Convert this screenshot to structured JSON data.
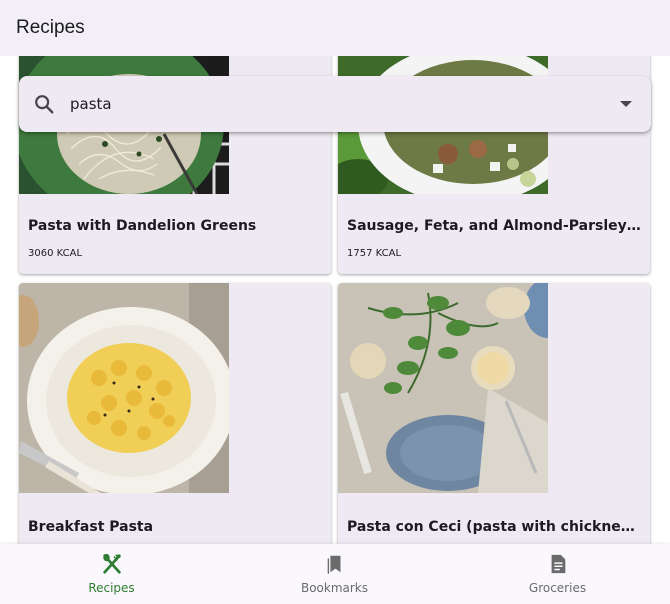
{
  "appbar": {
    "title": "Recipes"
  },
  "search": {
    "value": "pasta",
    "placeholder": ""
  },
  "recipes": [
    {
      "title": "Pasta with Dandelion Greens",
      "calories": "3060 KCAL"
    },
    {
      "title": "Sausage, Feta, and Almond-Parsley Pes...",
      "calories": "1757 KCAL"
    },
    {
      "title": "Breakfast Pasta",
      "calories": ""
    },
    {
      "title": "Pasta con Ceci (pasta with chickneas)",
      "calories": ""
    }
  ],
  "bottom_nav": {
    "items": [
      {
        "label": "Recipes",
        "icon": "restaurant-icon",
        "selected": true
      },
      {
        "label": "Bookmarks",
        "icon": "bookmarks-icon",
        "selected": false
      },
      {
        "label": "Groceries",
        "icon": "list-icon",
        "selected": false
      }
    ]
  },
  "colors": {
    "selected": "#2e7d32",
    "unselected": "#6b6b6b",
    "card": "#efe9f3",
    "appbar": "#f2eff6"
  }
}
